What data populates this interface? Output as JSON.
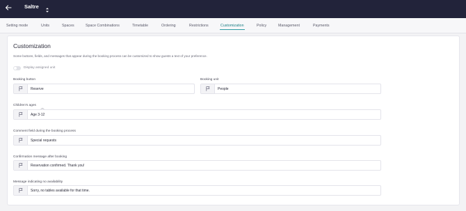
{
  "header": {
    "venue_name": "Saltre"
  },
  "tabs": [
    {
      "label": "Setting mode"
    },
    {
      "label": "Units"
    },
    {
      "label": "Spaces"
    },
    {
      "label": "Space Combinations"
    },
    {
      "label": "Timetable"
    },
    {
      "label": "Ordering"
    },
    {
      "label": "Restrictions"
    },
    {
      "label": "Customization"
    },
    {
      "label": "Policy"
    },
    {
      "label": "Management"
    },
    {
      "label": "Payments"
    }
  ],
  "active_tab": "Customization",
  "page": {
    "title": "Customization",
    "description": "Some buttons, fields, and messages that appear during the booking process can be customized to show guests a text of your preference.",
    "display_assigned_unit": {
      "label": "Display assigned unit",
      "enabled": false
    }
  },
  "fields": {
    "booking_button": {
      "label": "Booking button",
      "value": "Reserve"
    },
    "booking_unit": {
      "label": "Booking unit",
      "value": "People"
    },
    "childrens_ages": {
      "label": "Children's ages",
      "value": "Age 3-12"
    },
    "comment_field": {
      "label": "Comment field during the booking process",
      "value": "Special requests"
    },
    "confirmation_message": {
      "label": "Confirmation message after booking",
      "value": "Reservation confirmed. Thank you!"
    },
    "no_availability": {
      "label": "Message indicating no availability",
      "value": "Sorry, no tables available for that time."
    }
  },
  "icons": {
    "back": "arrow-left-icon",
    "venue_switch": "chevron-up-down-icon",
    "flag": "flag-icon",
    "info": "info-icon"
  },
  "colors": {
    "header_bg": "#22233a",
    "accent": "#2d9ca3",
    "card_bg": "#ffffff",
    "page_bg": "#f3f3f5"
  }
}
